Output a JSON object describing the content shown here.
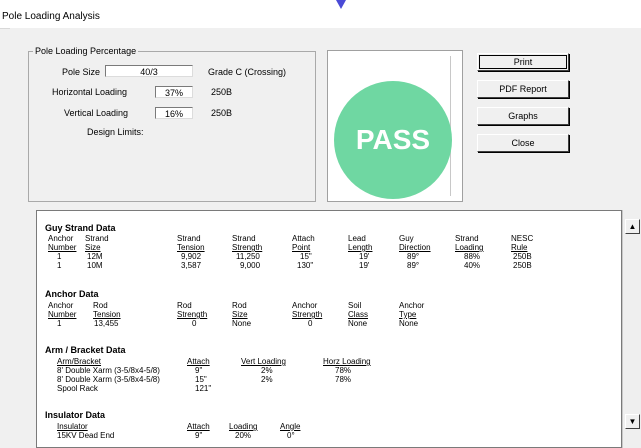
{
  "window": {
    "title": "Pole Loading Analysis"
  },
  "group": {
    "title": "Pole Loading Percentage",
    "pole_size_label": "Pole Size",
    "pole_size_value": "40/3",
    "grade_text": "Grade C (Crossing)",
    "horizontal_label": "Horizontal Loading",
    "horizontal_value": "37%",
    "horizontal_rule": "250B",
    "vertical_label": "Vertical Loading",
    "vertical_value": "16%",
    "vertical_rule": "250B",
    "design_limits_label": "Design Limits:"
  },
  "status": {
    "text": "PASS",
    "color": "#6fd7a2"
  },
  "buttons": {
    "print": "Print",
    "pdf_report": "PDF Report",
    "graphs": "Graphs",
    "close": "Close"
  },
  "report": {
    "guy_strand": {
      "title": "Guy Strand Data",
      "headers_top": [
        "Anchor",
        "Strand",
        "Strand",
        "Strand",
        "Attach",
        "Lead",
        "Guy",
        "Strand",
        "NESC"
      ],
      "headers_bottom": [
        "Number",
        "Size",
        "Tension",
        "Strength",
        "Point",
        "Length",
        "Direction",
        "Loading",
        "Rule"
      ],
      "rows": [
        [
          "1",
          "12M",
          "9,902",
          "11,250",
          "15\"",
          "19'",
          "89°",
          "88%",
          "250B"
        ],
        [
          "1",
          "10M",
          "3,587",
          "9,000",
          "130\"",
          "19'",
          "89°",
          "40%",
          "250B"
        ]
      ]
    },
    "anchor": {
      "title": "Anchor Data",
      "headers_top": [
        "Anchor",
        "Rod",
        "Rod",
        "Rod",
        "Anchor",
        "Soil",
        "Anchor"
      ],
      "headers_bottom": [
        "Number",
        "Tension",
        "Strength",
        "Size",
        "Strength",
        "Class",
        "Type"
      ],
      "rows": [
        [
          "1",
          "13,455",
          "0",
          "None",
          "0",
          "None",
          "None"
        ]
      ]
    },
    "arm_bracket": {
      "title": "Arm / Bracket Data",
      "headers": [
        "Arm/Bracket",
        "Attach",
        "Vert Loading",
        "Horz Loading"
      ],
      "rows": [
        [
          "8' Double Xarm (3-5/8x4-5/8)",
          "9\"",
          "2%",
          "78%"
        ],
        [
          "8' Double Xarm (3-5/8x4-5/8)",
          "15\"",
          "2%",
          "78%"
        ],
        [
          "Spool Rack",
          "121\"",
          "",
          ""
        ]
      ]
    },
    "insulator": {
      "title": "Insulator Data",
      "headers": [
        "Insulator",
        "Attach",
        "Loading",
        "Angle"
      ],
      "rows": [
        [
          "15KV Dead End",
          "9\"",
          "20%",
          "0°"
        ]
      ]
    }
  }
}
